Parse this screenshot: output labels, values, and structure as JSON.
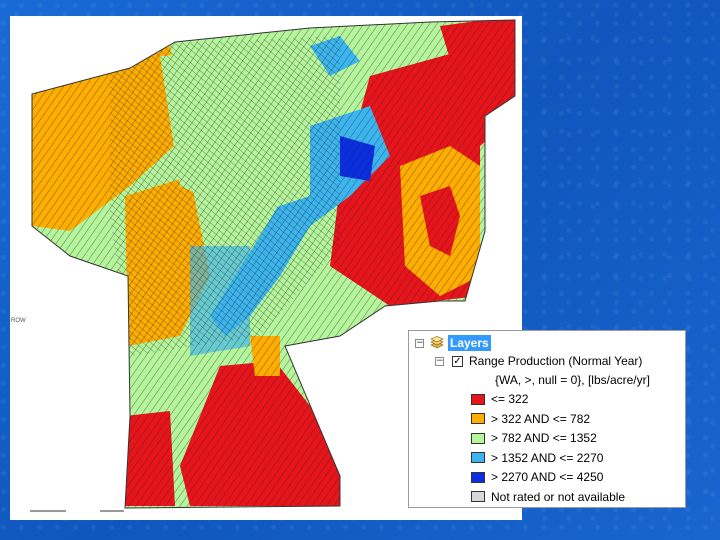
{
  "legend": {
    "title": "Layers",
    "layer_name": "Range Production (Normal Year)",
    "layer_subtitle": "{WA, >, null = 0}, [lbs/acre/yr]",
    "classes": [
      {
        "label": "<= 322",
        "color": "#e8141b"
      },
      {
        "label": "> 322 AND <= 782",
        "color": "#ffae00"
      },
      {
        "label": "> 782 AND <= 1352",
        "color": "#b5f59c"
      },
      {
        "label": "> 1352 AND <= 2270",
        "color": "#3cb5ee"
      },
      {
        "label": "> 2270 AND <= 4250",
        "color": "#0a2ee0"
      },
      {
        "label": "Not rated or not available",
        "color": "#d8d8d8"
      }
    ]
  },
  "map": {
    "edge_label": "ROW"
  }
}
